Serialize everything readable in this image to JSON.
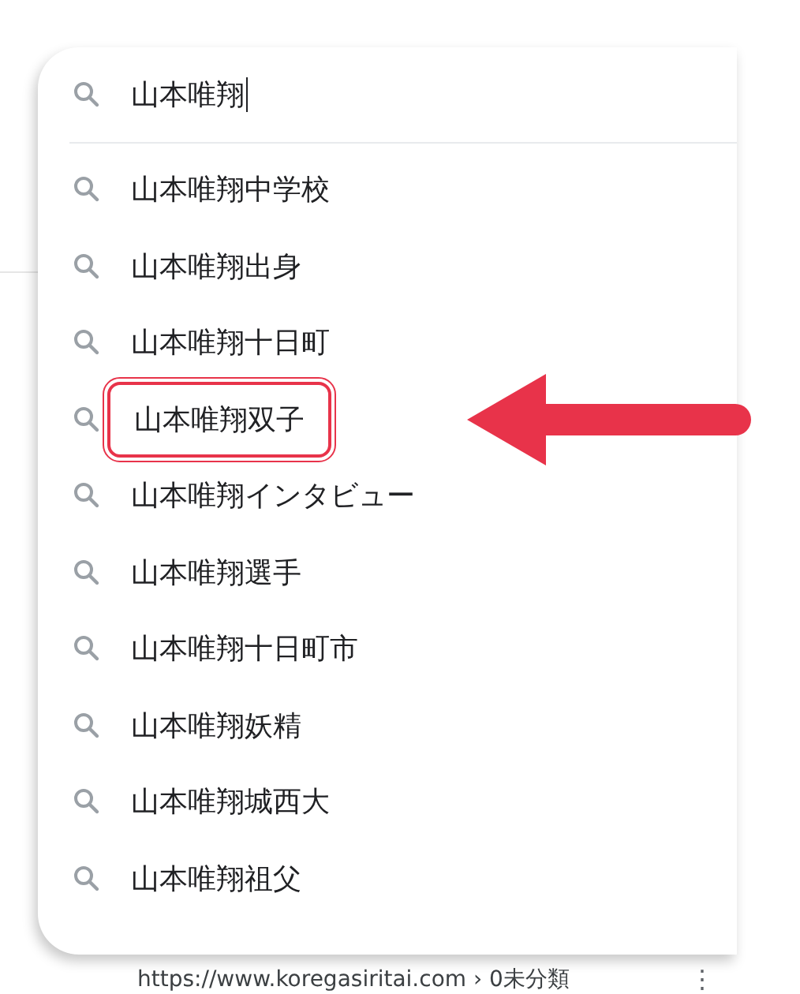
{
  "search": {
    "value": "山本唯翔"
  },
  "suggestions": [
    {
      "text": "山本唯翔中学校",
      "highlighted": false
    },
    {
      "text": "山本唯翔出身",
      "highlighted": false
    },
    {
      "text": "山本唯翔十日町",
      "highlighted": false
    },
    {
      "text": "山本唯翔双子",
      "highlighted": true
    },
    {
      "text": "山本唯翔インタビュー",
      "highlighted": false
    },
    {
      "text": "山本唯翔選手",
      "highlighted": false
    },
    {
      "text": "山本唯翔十日町市",
      "highlighted": false
    },
    {
      "text": "山本唯翔妖精",
      "highlighted": false
    },
    {
      "text": "山本唯翔城西大",
      "highlighted": false
    },
    {
      "text": "山本唯翔祖父",
      "highlighted": false
    }
  ],
  "result": {
    "url": "https://www.koregasiritai.com › 0未分類",
    "menu": "⋮"
  }
}
